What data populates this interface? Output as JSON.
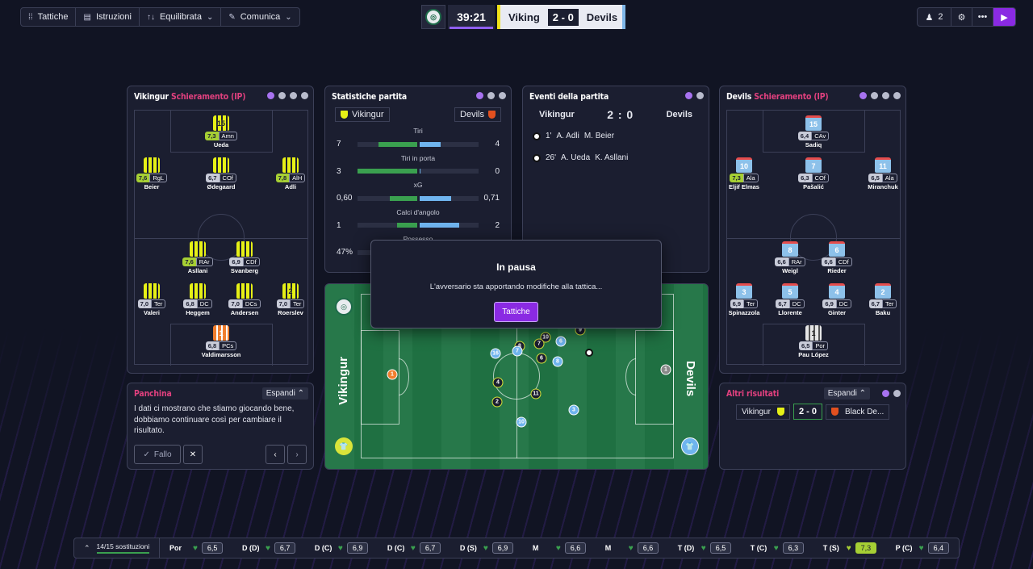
{
  "toolbar": {
    "tactics": "Tattiche",
    "instructions": "Istruzioni",
    "mentality": "Equilibrata",
    "communicate": "Comunica"
  },
  "scoreboard": {
    "clock": "39:21",
    "home": "Viking",
    "score": "2 - 0",
    "away": "Devils",
    "home_color": "#f0e21a",
    "away_color": "#7fb7e8"
  },
  "topright": {
    "people_count": "2"
  },
  "home_lineup": {
    "team": "Vikingur",
    "title": "Schieramento (IP)",
    "players": [
      {
        "num": "15",
        "name": "Ueda",
        "rating": "7,3",
        "pos": "Amn",
        "hi": true,
        "ball": true
      },
      {
        "num": "",
        "name": "Beier",
        "rating": "7,6",
        "pos": "RgL",
        "hi": true
      },
      {
        "num": "",
        "name": "Ødegaard",
        "rating": "6,7",
        "pos": "COf"
      },
      {
        "num": "",
        "name": "Adli",
        "rating": "7,8",
        "pos": "AlH",
        "hi": true,
        "ball": true
      },
      {
        "num": "",
        "name": "Asllani",
        "rating": "7,6",
        "pos": "RAr",
        "hi": true
      },
      {
        "num": "",
        "name": "Svanberg",
        "rating": "6,9",
        "pos": "CDf"
      },
      {
        "num": "",
        "name": "Valeri",
        "rating": "7,0",
        "pos": "Ter"
      },
      {
        "num": "",
        "name": "Heggem",
        "rating": "6,8",
        "pos": "DC"
      },
      {
        "num": "",
        "name": "Andersen",
        "rating": "7,0",
        "pos": "DCs"
      },
      {
        "num": "2",
        "name": "Roerslev",
        "rating": "7,0",
        "pos": "Ter"
      },
      {
        "num": "1",
        "name": "Valdimarsson",
        "rating": "6,8",
        "pos": "PCs"
      }
    ]
  },
  "stats": {
    "title": "Statistiche partita",
    "home": "Vikingur",
    "away": "Devils",
    "rows": [
      {
        "label": "Tiri",
        "home": "7",
        "away": "4",
        "h": 0.64,
        "a": 0.36
      },
      {
        "label": "Tiri in porta",
        "home": "3",
        "away": "0",
        "h": 1.0,
        "a": 0.02
      },
      {
        "label": "xG",
        "home": "0,60",
        "away": "0,71",
        "h": 0.46,
        "a": 0.54
      },
      {
        "label": "Calci d'angolo",
        "home": "1",
        "away": "2",
        "h": 0.33,
        "a": 0.67
      },
      {
        "label": "Possesso",
        "home": "47%",
        "away": "",
        "h": 0.47,
        "a": 0.53
      }
    ]
  },
  "events": {
    "title": "Eventi della partita",
    "home": "Vikingur",
    "score": "2 : 0",
    "away": "Devils",
    "items": [
      {
        "minute": "1'",
        "scorer": "A. Adli",
        "assist": "M. Beier"
      },
      {
        "minute": "26'",
        "scorer": "A. Ueda",
        "assist": "K. Asllani"
      }
    ]
  },
  "away_lineup": {
    "team": "Devils",
    "title": "Schieramento (IP)",
    "players": [
      {
        "num": "15",
        "name": "Sadiq",
        "rating": "6,4",
        "pos": "CAv"
      },
      {
        "num": "10",
        "name": "Eljif Elmas",
        "rating": "7,3",
        "pos": "Ala",
        "hi": true
      },
      {
        "num": "7",
        "name": "Pašalić",
        "rating": "6,3",
        "pos": "COf"
      },
      {
        "num": "11",
        "name": "Miranchuk",
        "rating": "6,5",
        "pos": "Ala"
      },
      {
        "num": "8",
        "name": "Weigl",
        "rating": "6,6",
        "pos": "RAr"
      },
      {
        "num": "6",
        "name": "Rieder",
        "rating": "6,6",
        "pos": "CDf"
      },
      {
        "num": "3",
        "name": "Spinazzola",
        "rating": "6,9",
        "pos": "Ter"
      },
      {
        "num": "5",
        "name": "Llorente",
        "rating": "6,7",
        "pos": "DC"
      },
      {
        "num": "4",
        "name": "Ginter",
        "rating": "6,9",
        "pos": "DC"
      },
      {
        "num": "2",
        "name": "Baku",
        "rating": "6,7",
        "pos": "Ter"
      },
      {
        "num": "1",
        "name": "Pau López",
        "rating": "6,5",
        "pos": "Por"
      }
    ]
  },
  "modal": {
    "title": "In pausa",
    "message": "L'avversario sta apportando modifiche alla tattica...",
    "button": "Tattiche"
  },
  "field": {
    "home_label": "Vikingur",
    "away_label": "Devils"
  },
  "bench": {
    "title": "Panchina",
    "expand": "Espandi",
    "message": "I dati ci mostrano che stiamo giocando bene, dobbiamo continuare così per cambiare il risultato.",
    "do_it": "Fallo"
  },
  "other_results": {
    "title": "Altri risultati",
    "expand": "Espandi",
    "home": "Vikingur",
    "score": "2 - 0",
    "away": "Black De..."
  },
  "bottom": {
    "subs": "14/15 sostituzioni",
    "positions": [
      {
        "label": "Por",
        "value": "6,5"
      },
      {
        "label": "D (D)",
        "value": "6,7"
      },
      {
        "label": "D (C)",
        "value": "6,9"
      },
      {
        "label": "D (C)",
        "value": "6,7"
      },
      {
        "label": "D (S)",
        "value": "6,9"
      },
      {
        "label": "M",
        "value": "6,6"
      },
      {
        "label": "M",
        "value": "6,6"
      },
      {
        "label": "T (D)",
        "value": "6,5"
      },
      {
        "label": "T (C)",
        "value": "6,3"
      },
      {
        "label": "T (S)",
        "value": "7,3",
        "hi": true
      },
      {
        "label": "P (C)",
        "value": "6,4"
      }
    ]
  }
}
